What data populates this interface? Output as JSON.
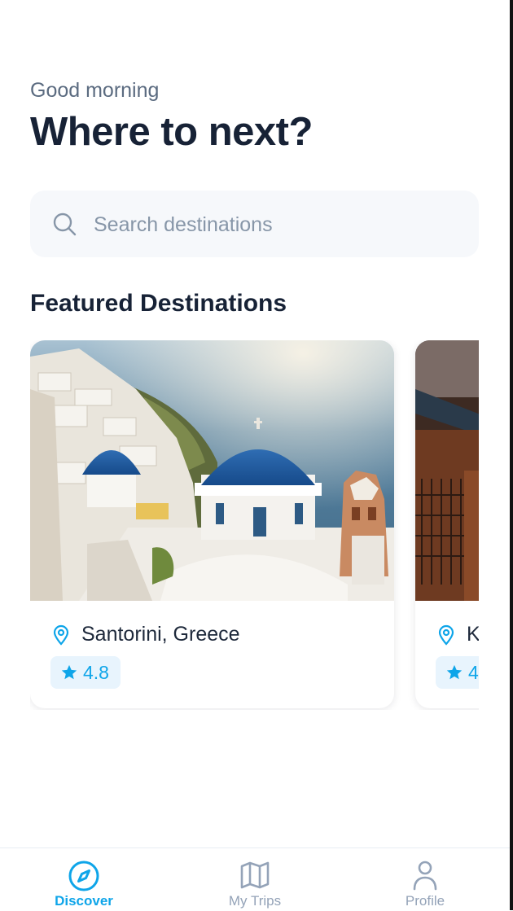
{
  "header": {
    "greeting": "Good morning",
    "title": "Where to next?"
  },
  "search": {
    "placeholder": "Search destinations",
    "icon": "search-icon"
  },
  "featured": {
    "title": "Featured Destinations",
    "cards": [
      {
        "name": "Santorini, Greece",
        "rating": "4.8",
        "location_icon": "map-pin-icon",
        "rating_icon": "star-icon"
      },
      {
        "name": "K",
        "rating": "4",
        "location_icon": "map-pin-icon",
        "rating_icon": "star-icon"
      }
    ]
  },
  "tabbar": {
    "tabs": [
      {
        "label": "Discover",
        "icon": "compass-icon",
        "active": true
      },
      {
        "label": "My Trips",
        "icon": "map-icon",
        "active": false
      },
      {
        "label": "Profile",
        "icon": "user-icon",
        "active": false
      }
    ]
  },
  "colors": {
    "accent": "#0ea5e9",
    "title": "#172236",
    "muted": "#5b6b80",
    "search_bg": "#f6f8fb",
    "rating_bg": "#e8f4fd",
    "tab_inactive": "#94a3b8"
  }
}
